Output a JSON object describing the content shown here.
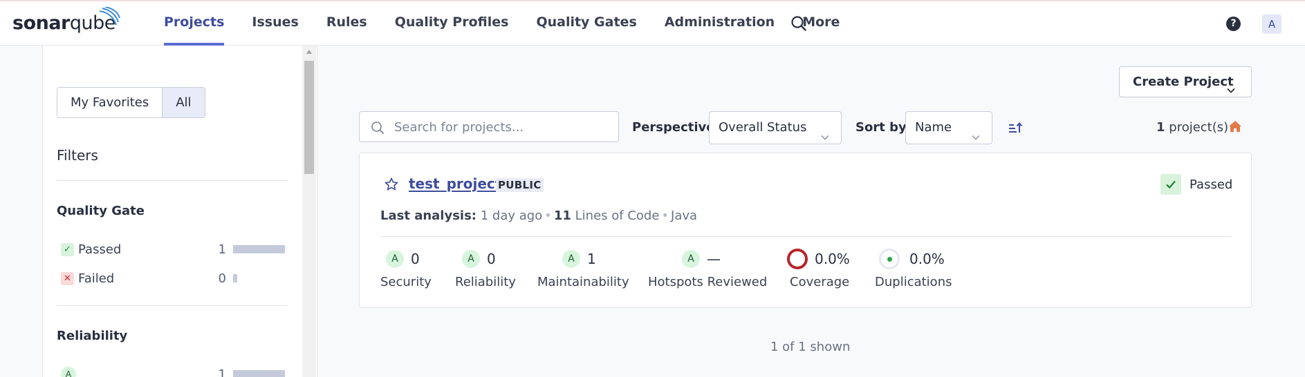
{
  "app": {
    "logo_text_bold": "sonar",
    "logo_text_rest": "qube"
  },
  "nav": {
    "items": [
      "Projects",
      "Issues",
      "Rules",
      "Quality Profiles",
      "Quality Gates",
      "Administration",
      "More"
    ],
    "active_index": 0,
    "help_label": "?",
    "avatar_initial": "A"
  },
  "sidebar": {
    "toggle": {
      "favorites": "My Favorites",
      "all": "All",
      "selected": "All"
    },
    "filters_title": "Filters",
    "quality_gate": {
      "title": "Quality Gate",
      "items": [
        {
          "label": "Passed",
          "count": "1",
          "status": "passed"
        },
        {
          "label": "Failed",
          "count": "0",
          "status": "failed"
        }
      ]
    },
    "reliability": {
      "title": "Reliability",
      "items": [
        {
          "rating": "A",
          "count": "1"
        }
      ]
    }
  },
  "toolbar": {
    "create_project": "Create Project",
    "search_placeholder": "Search for projects...",
    "perspective_label": "Perspective",
    "perspective_value": "Overall Status",
    "sort_label": "Sort by",
    "sort_value": "Name",
    "count_number": "1",
    "count_suffix": "project(s)"
  },
  "project": {
    "name": "test_project",
    "visibility": "PUBLIC",
    "quality_gate": "Passed",
    "last_analysis_label": "Last analysis:",
    "last_analysis_value": "1 day ago",
    "loc_count": "11",
    "loc_label": "Lines of Code",
    "language": "Java",
    "metrics": {
      "security": {
        "rating": "A",
        "value": "0",
        "label": "Security"
      },
      "reliability": {
        "rating": "A",
        "value": "0",
        "label": "Reliability"
      },
      "maintainability": {
        "rating": "A",
        "value": "1",
        "label": "Maintainability"
      },
      "hotspots": {
        "rating": "A",
        "value": "—",
        "label": "Hotspots Reviewed"
      },
      "coverage": {
        "value": "0.0%",
        "label": "Coverage"
      },
      "duplications": {
        "value": "0.0%",
        "label": "Duplications"
      }
    }
  },
  "footer": {
    "shown": "1 of 1 shown"
  },
  "colors": {
    "accent": "#5d6cd0",
    "passed": "#238a3c",
    "failed": "#c12f2f",
    "coverage_ring": "#b5262b",
    "home": "#e07b4a"
  }
}
